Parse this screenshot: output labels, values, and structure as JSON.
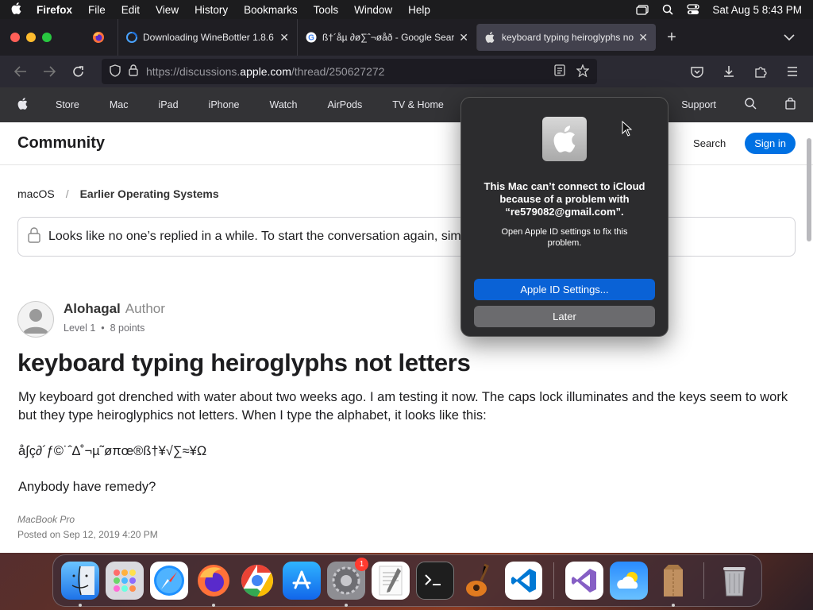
{
  "menubar": {
    "app_name": "Firefox",
    "menus": [
      "File",
      "Edit",
      "View",
      "History",
      "Bookmarks",
      "Tools",
      "Window",
      "Help"
    ],
    "clock": "Sat Aug 5  8:43 PM"
  },
  "tabs": [
    {
      "title": "Downloading WineBottler 1.8.6 |",
      "active": false
    },
    {
      "title": "ß†´åµ ∂ø∑ˆ¬øåð - Google Sear",
      "active": false
    },
    {
      "title": "keyboard typing heiroglyphs not",
      "active": true
    }
  ],
  "url": {
    "prefix": "https://discussions.",
    "domain": "apple.com",
    "path": "/thread/250627272"
  },
  "apple_nav": {
    "items": [
      "Store",
      "Mac",
      "iPad",
      "iPhone",
      "Watch",
      "AirPods",
      "TV & Home"
    ],
    "support": "Support"
  },
  "community": {
    "title": "Community",
    "search": "Search",
    "sign_in": "Sign in"
  },
  "breadcrumb": {
    "parent": "macOS",
    "separator": "/",
    "current": "Earlier Operating Systems"
  },
  "notice": "Looks like no one’s replied in a while. To start the conversation again, simply ask a new question.",
  "post": {
    "author": "Alohagal",
    "role": "Author",
    "level": "Level 1",
    "points": "8 points",
    "title": "keyboard typing heiroglyphs not letters",
    "body1": "My keyboard got drenched with water about two weeks ago. I am testing it now. The caps lock illuminates and the keys seem to work but they type heiroglyphics not letters. When I type the alphabet, it looks like this:",
    "body2": "å∫ç∂´ƒ©˙ˆ∆˚¬µ˜øπœ®ß†¥√∑≈¥Ω",
    "body3": "Anybody have remedy?",
    "device": "MacBook Pro",
    "posted": "Posted on Sep 12, 2019 4:20 PM"
  },
  "alert": {
    "title": "This Mac can’t connect to iCloud because of a problem with “re579082@gmail.com”.",
    "message": "Open Apple ID settings to fix this problem.",
    "primary": "Apple ID Settings...",
    "secondary": "Later"
  },
  "dock": {
    "apps": [
      "finder-icon",
      "launchpad-icon",
      "safari-icon",
      "firefox-icon",
      "chrome-icon",
      "app-store-icon",
      "system-settings-icon",
      "textedit-icon",
      "terminal-icon",
      "garageband-icon",
      "vscode-icon",
      "visual-studio-icon",
      "weather-icon",
      "archive-utility-icon",
      "trash-icon"
    ],
    "settings_badge": "1"
  }
}
